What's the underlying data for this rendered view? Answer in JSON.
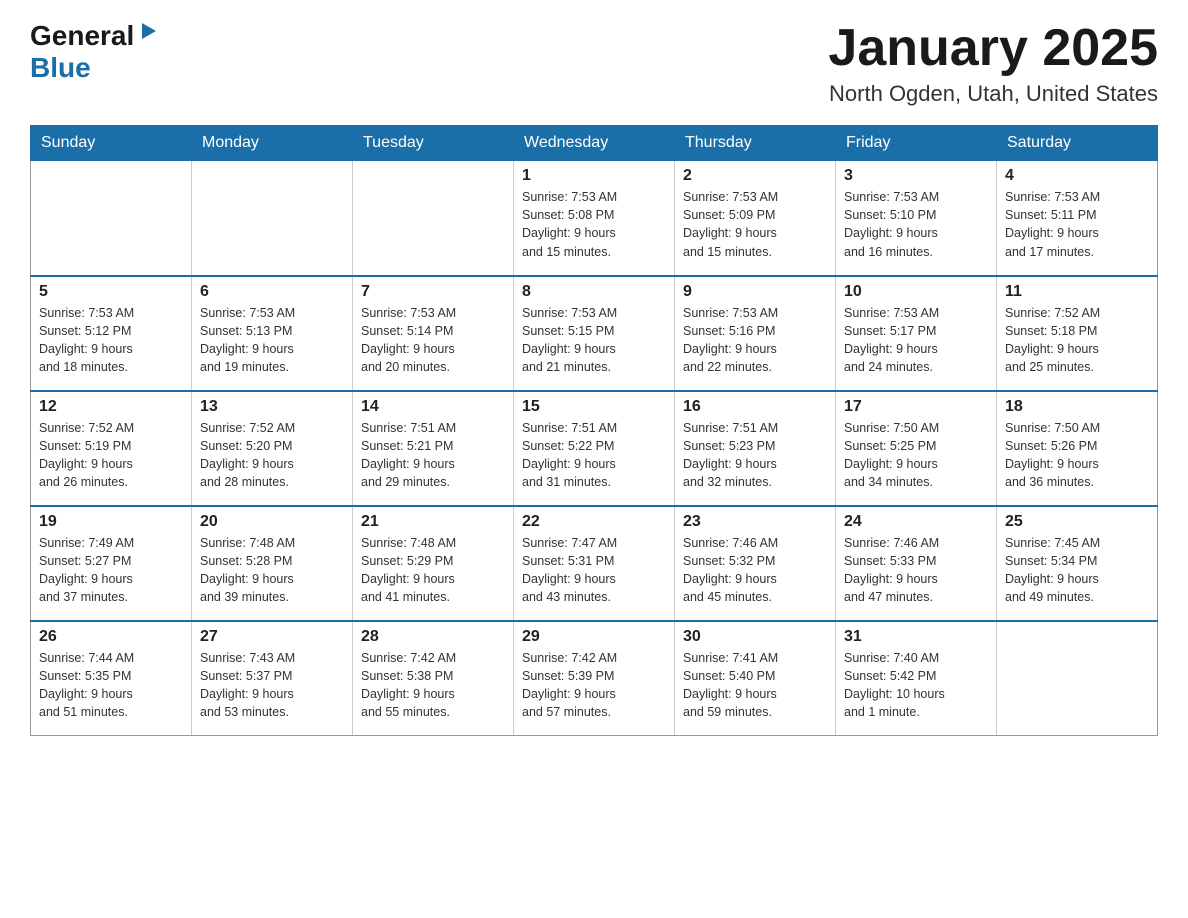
{
  "header": {
    "logo": {
      "general": "General",
      "arrow": "▶",
      "blue": "Blue"
    },
    "title": "January 2025",
    "subtitle": "North Ogden, Utah, United States"
  },
  "days_of_week": [
    "Sunday",
    "Monday",
    "Tuesday",
    "Wednesday",
    "Thursday",
    "Friday",
    "Saturday"
  ],
  "weeks": [
    {
      "days": [
        {
          "number": "",
          "info": ""
        },
        {
          "number": "",
          "info": ""
        },
        {
          "number": "",
          "info": ""
        },
        {
          "number": "1",
          "info": "Sunrise: 7:53 AM\nSunset: 5:08 PM\nDaylight: 9 hours\nand 15 minutes."
        },
        {
          "number": "2",
          "info": "Sunrise: 7:53 AM\nSunset: 5:09 PM\nDaylight: 9 hours\nand 15 minutes."
        },
        {
          "number": "3",
          "info": "Sunrise: 7:53 AM\nSunset: 5:10 PM\nDaylight: 9 hours\nand 16 minutes."
        },
        {
          "number": "4",
          "info": "Sunrise: 7:53 AM\nSunset: 5:11 PM\nDaylight: 9 hours\nand 17 minutes."
        }
      ]
    },
    {
      "days": [
        {
          "number": "5",
          "info": "Sunrise: 7:53 AM\nSunset: 5:12 PM\nDaylight: 9 hours\nand 18 minutes."
        },
        {
          "number": "6",
          "info": "Sunrise: 7:53 AM\nSunset: 5:13 PM\nDaylight: 9 hours\nand 19 minutes."
        },
        {
          "number": "7",
          "info": "Sunrise: 7:53 AM\nSunset: 5:14 PM\nDaylight: 9 hours\nand 20 minutes."
        },
        {
          "number": "8",
          "info": "Sunrise: 7:53 AM\nSunset: 5:15 PM\nDaylight: 9 hours\nand 21 minutes."
        },
        {
          "number": "9",
          "info": "Sunrise: 7:53 AM\nSunset: 5:16 PM\nDaylight: 9 hours\nand 22 minutes."
        },
        {
          "number": "10",
          "info": "Sunrise: 7:53 AM\nSunset: 5:17 PM\nDaylight: 9 hours\nand 24 minutes."
        },
        {
          "number": "11",
          "info": "Sunrise: 7:52 AM\nSunset: 5:18 PM\nDaylight: 9 hours\nand 25 minutes."
        }
      ]
    },
    {
      "days": [
        {
          "number": "12",
          "info": "Sunrise: 7:52 AM\nSunset: 5:19 PM\nDaylight: 9 hours\nand 26 minutes."
        },
        {
          "number": "13",
          "info": "Sunrise: 7:52 AM\nSunset: 5:20 PM\nDaylight: 9 hours\nand 28 minutes."
        },
        {
          "number": "14",
          "info": "Sunrise: 7:51 AM\nSunset: 5:21 PM\nDaylight: 9 hours\nand 29 minutes."
        },
        {
          "number": "15",
          "info": "Sunrise: 7:51 AM\nSunset: 5:22 PM\nDaylight: 9 hours\nand 31 minutes."
        },
        {
          "number": "16",
          "info": "Sunrise: 7:51 AM\nSunset: 5:23 PM\nDaylight: 9 hours\nand 32 minutes."
        },
        {
          "number": "17",
          "info": "Sunrise: 7:50 AM\nSunset: 5:25 PM\nDaylight: 9 hours\nand 34 minutes."
        },
        {
          "number": "18",
          "info": "Sunrise: 7:50 AM\nSunset: 5:26 PM\nDaylight: 9 hours\nand 36 minutes."
        }
      ]
    },
    {
      "days": [
        {
          "number": "19",
          "info": "Sunrise: 7:49 AM\nSunset: 5:27 PM\nDaylight: 9 hours\nand 37 minutes."
        },
        {
          "number": "20",
          "info": "Sunrise: 7:48 AM\nSunset: 5:28 PM\nDaylight: 9 hours\nand 39 minutes."
        },
        {
          "number": "21",
          "info": "Sunrise: 7:48 AM\nSunset: 5:29 PM\nDaylight: 9 hours\nand 41 minutes."
        },
        {
          "number": "22",
          "info": "Sunrise: 7:47 AM\nSunset: 5:31 PM\nDaylight: 9 hours\nand 43 minutes."
        },
        {
          "number": "23",
          "info": "Sunrise: 7:46 AM\nSunset: 5:32 PM\nDaylight: 9 hours\nand 45 minutes."
        },
        {
          "number": "24",
          "info": "Sunrise: 7:46 AM\nSunset: 5:33 PM\nDaylight: 9 hours\nand 47 minutes."
        },
        {
          "number": "25",
          "info": "Sunrise: 7:45 AM\nSunset: 5:34 PM\nDaylight: 9 hours\nand 49 minutes."
        }
      ]
    },
    {
      "days": [
        {
          "number": "26",
          "info": "Sunrise: 7:44 AM\nSunset: 5:35 PM\nDaylight: 9 hours\nand 51 minutes."
        },
        {
          "number": "27",
          "info": "Sunrise: 7:43 AM\nSunset: 5:37 PM\nDaylight: 9 hours\nand 53 minutes."
        },
        {
          "number": "28",
          "info": "Sunrise: 7:42 AM\nSunset: 5:38 PM\nDaylight: 9 hours\nand 55 minutes."
        },
        {
          "number": "29",
          "info": "Sunrise: 7:42 AM\nSunset: 5:39 PM\nDaylight: 9 hours\nand 57 minutes."
        },
        {
          "number": "30",
          "info": "Sunrise: 7:41 AM\nSunset: 5:40 PM\nDaylight: 9 hours\nand 59 minutes."
        },
        {
          "number": "31",
          "info": "Sunrise: 7:40 AM\nSunset: 5:42 PM\nDaylight: 10 hours\nand 1 minute."
        },
        {
          "number": "",
          "info": ""
        }
      ]
    }
  ]
}
